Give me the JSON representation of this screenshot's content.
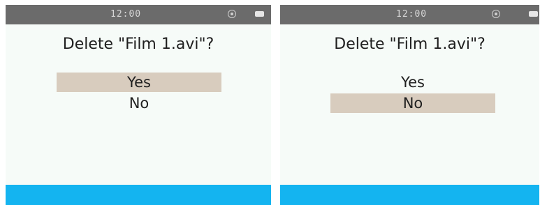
{
  "screens": [
    {
      "status_time": "12:00",
      "status_icon": "settings-icon",
      "battery_icon": "battery-icon",
      "dialog_title": "Delete \"Film 1.avi\"?",
      "options": [
        {
          "label": "Yes",
          "selected": true
        },
        {
          "label": "No",
          "selected": false
        }
      ]
    },
    {
      "status_time": "12:00",
      "status_icon": "settings-icon",
      "battery_icon": "battery-icon",
      "dialog_title": "Delete \"Film 1.avi\"?",
      "options": [
        {
          "label": "Yes",
          "selected": false
        },
        {
          "label": "No",
          "selected": true
        }
      ]
    }
  ],
  "colors": {
    "status_bar": "#6b6b6b",
    "screen_background": "#f6fbf8",
    "selection_highlight": "#d8ccbe",
    "bottom_bar": "#14b4f0",
    "text": "#1f1f1f"
  }
}
